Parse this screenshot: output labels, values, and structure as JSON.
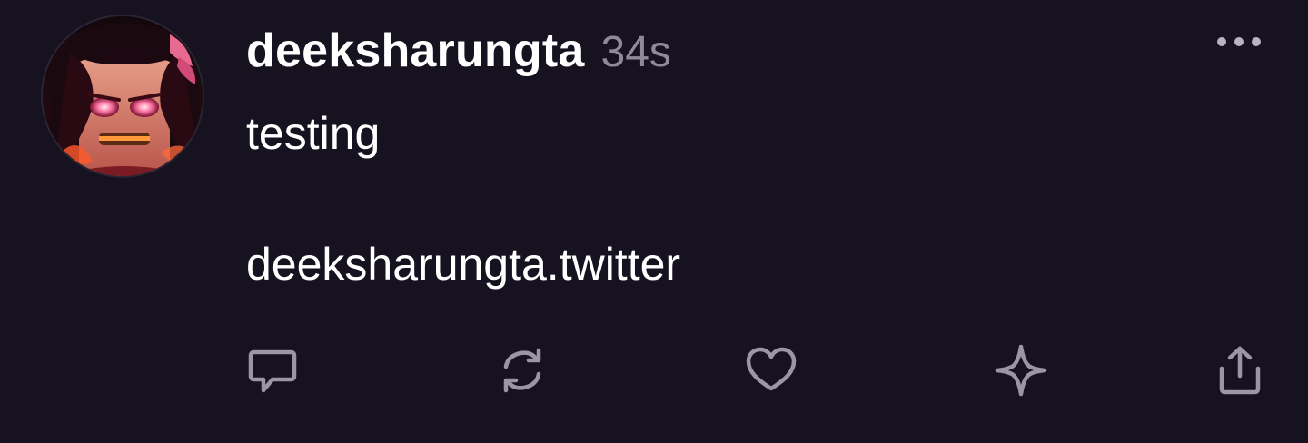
{
  "post": {
    "username": "deeksharungta",
    "timestamp": "34s",
    "text_line_1": "testing",
    "text_line_2": "deeksharungta.twitter"
  },
  "avatar": {
    "icon": "avatar-anime-character"
  },
  "actions": {
    "reply_icon": "reply-icon",
    "repost_icon": "repost-icon",
    "like_icon": "heart-icon",
    "sparkle_icon": "sparkle-icon",
    "share_icon": "share-icon",
    "more_icon": "more-options-icon"
  },
  "colors": {
    "background": "#161220",
    "primary_text": "#ffffff",
    "secondary_text": "#8e8a99",
    "icon": "#9a96a6"
  }
}
